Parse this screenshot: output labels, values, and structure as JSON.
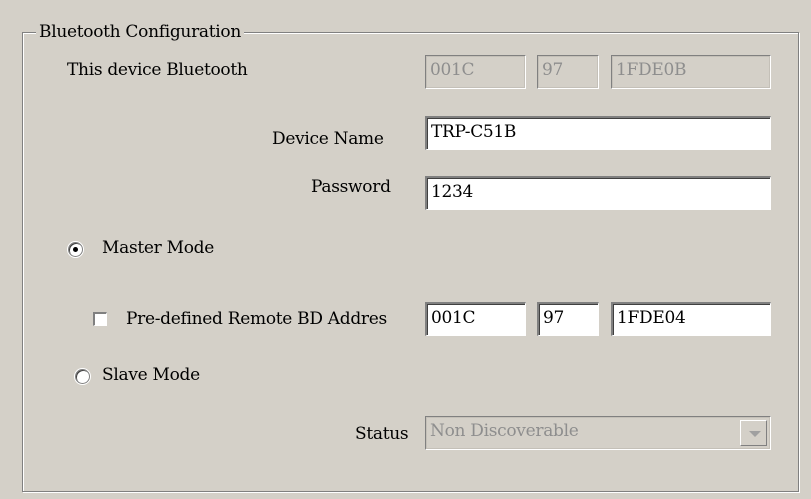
{
  "group": {
    "title": "Bluetooth Configuration"
  },
  "device_bt": {
    "label": "This device Bluetooth",
    "addr1": "001C",
    "addr2": "97",
    "addr3": "1FDE0B"
  },
  "device_name": {
    "label": "Device Name",
    "value": "TRP-C51B"
  },
  "password": {
    "label": "Password",
    "value": "1234"
  },
  "master_mode": {
    "label": "Master Mode",
    "selected": true
  },
  "predefined": {
    "label": "Pre-defined Remote BD Addres",
    "checked": false,
    "addr1": "001C",
    "addr2": "97",
    "addr3": "1FDE04"
  },
  "slave_mode": {
    "label": "Slave Mode",
    "selected": false
  },
  "status": {
    "label": "Status",
    "value": "Non Discoverable"
  }
}
